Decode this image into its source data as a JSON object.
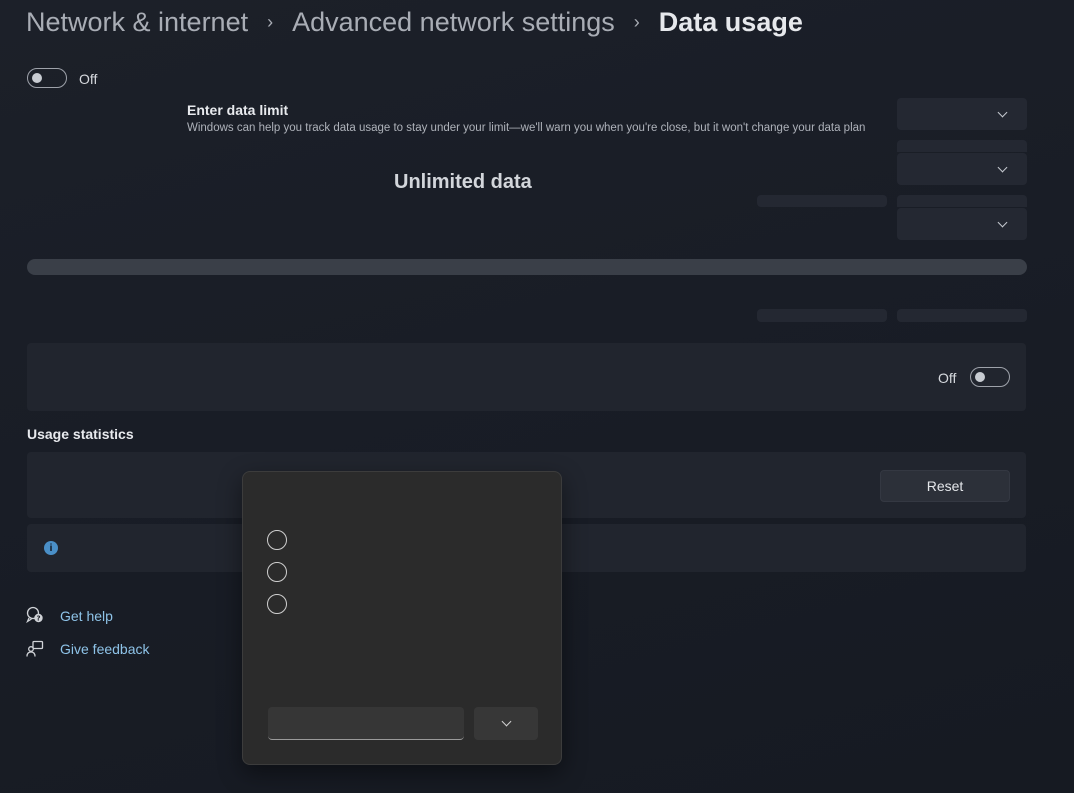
{
  "breadcrumb": {
    "items": [
      "Network & internet",
      "Advanced network settings",
      "Data usage"
    ],
    "separator": "›"
  },
  "metered_toggle": {
    "state_label": "Off"
  },
  "data_limit": {
    "title": "Enter data limit",
    "description": "Windows can help you track data usage to stay under your limit—we'll warn you when you're close, but it won't change your data plan",
    "status": "Unlimited data"
  },
  "background_data": {
    "state_label": "Off"
  },
  "usage_statistics": {
    "heading": "Usage statistics",
    "reset_label": "Reset",
    "info_icon": "i"
  },
  "help": {
    "get_help": "Get help",
    "give_feedback": "Give feedback"
  },
  "colors": {
    "background": "#1a1e27",
    "link": "#8ec3e8",
    "accent_info": "#4a8fc7",
    "popup": "#2b2b2b"
  }
}
